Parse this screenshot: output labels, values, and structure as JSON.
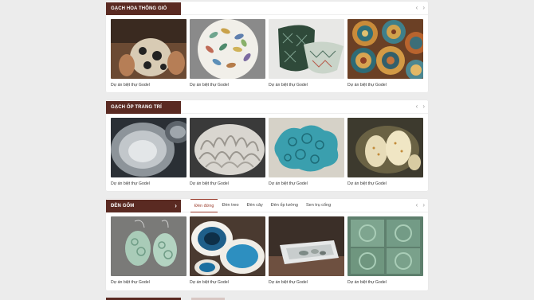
{
  "sections": [
    {
      "title": "GẠCH HOA THÔNG GIÓ",
      "nav": {
        "prev": "‹",
        "next": "›"
      },
      "items": [
        {
          "caption": "Dự án biệt thự Godel",
          "image": "hands-polka-dot-vase"
        },
        {
          "caption": "Dự án biệt thự Godel",
          "image": "leaf-pattern-plate"
        },
        {
          "caption": "Dự án biệt thự Godel",
          "image": "geometric-bowls"
        },
        {
          "caption": "Dự án biệt thự Godel",
          "image": "mosaic-plates"
        }
      ]
    },
    {
      "title": "GẠCH ỐP TRANG TRÍ",
      "nav": {
        "prev": "‹",
        "next": "›"
      },
      "items": [
        {
          "caption": "Dự án biệt thự Godel",
          "image": "grey-bowls"
        },
        {
          "caption": "Dự án biệt thự Godel",
          "image": "white-coral-sculpture"
        },
        {
          "caption": "Dự án biệt thự Godel",
          "image": "turquoise-turtle-dish"
        },
        {
          "caption": "Dự án biệt thự Godel",
          "image": "ceramic-lanterns"
        }
      ]
    },
    {
      "title": "ĐÈN GỐM",
      "title_arrow": "›",
      "tabs": [
        "Đèn đứng",
        "Đèn treo",
        "Đèn cây",
        "Đèn ốp tường",
        "Sen trụ cổng"
      ],
      "nav": {
        "prev": "‹",
        "next": "›"
      },
      "items": [
        {
          "caption": "Dự án biệt thự Godel",
          "image": "celadon-earrings"
        },
        {
          "caption": "Dự án biệt thự Godel",
          "image": "blue-bowls"
        },
        {
          "caption": "Dự án biệt thự Godel",
          "image": "white-tray-pebbles"
        },
        {
          "caption": "Dự án biệt thự Godel",
          "image": "green-flower-tiles"
        }
      ]
    }
  ],
  "colors": {
    "accent": "#5a2a22",
    "tab_active": "#9a3b2b",
    "background": "#ececec"
  }
}
